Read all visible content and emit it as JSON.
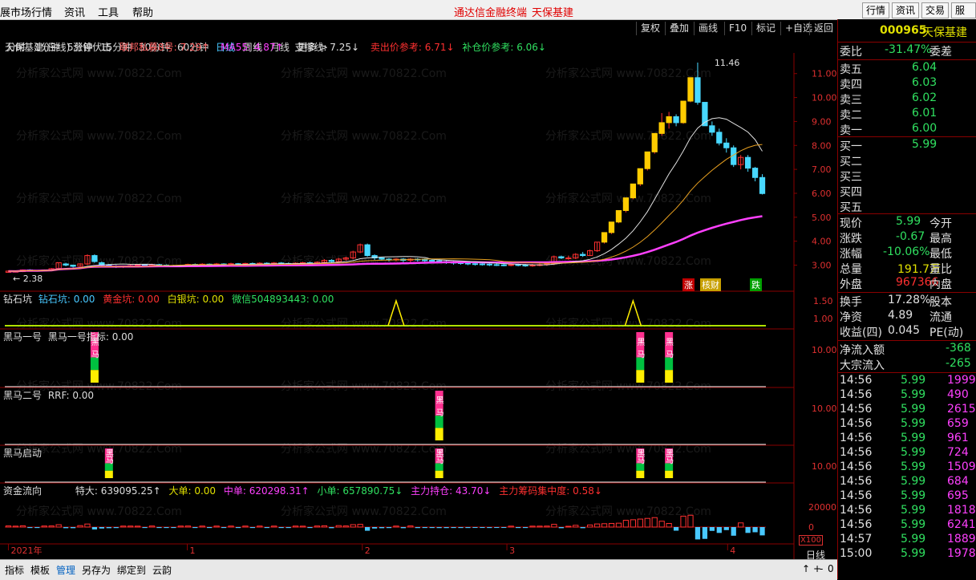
{
  "menu": {
    "app_title": "展市场行情",
    "items": [
      "资讯",
      "工具",
      "帮助"
    ],
    "center_title": "通达信金融终端",
    "stock_title": "天保基建",
    "right_buttons": [
      "行情",
      "资讯",
      "交易",
      "服务"
    ]
  },
  "toolbar": {
    "buttons": [
      "复权",
      "叠加",
      "画线",
      "F10",
      "标记",
      "+自选",
      "返回"
    ]
  },
  "timeframes": {
    "items": [
      "分时",
      "1分钟",
      "5分钟",
      "15分钟",
      "30分钟",
      "60分钟",
      "日线",
      "周线",
      "月线",
      "更多 >"
    ],
    "active": "日线"
  },
  "main_panel": {
    "header": [
      {
        "text": "天保基建(日线) 涨停伏击",
        "color": "#dddddd"
      },
      {
        "text": "联邦私募8号: 7.29↑",
        "color": "#ff6060"
      },
      {
        "text": "MA55: 4.87↑",
        "color": "#ff40ff"
      },
      {
        "text": "支撑线: 7.25↓",
        "color": "#e0e0e0"
      },
      {
        "text": "卖出价参考: 6.71↓",
        "color": "#ff3030"
      },
      {
        "text": "补仓价参考: 6.06↓",
        "color": "#30e060"
      }
    ],
    "y_ticks": [
      "11.00",
      "10.00",
      "9.00",
      "8.00",
      "7.00",
      "6.00",
      "5.00",
      "4.00",
      "3.00"
    ],
    "max_label": "11.46",
    "min_label": "2.38",
    "markers": [
      {
        "text": "涨",
        "bg": "#c00000"
      },
      {
        "text": "核财",
        "bg": "#c8a000"
      },
      {
        "text": "跌",
        "bg": "#00a000"
      }
    ]
  },
  "chart_data": {
    "type": "candlestick",
    "price_range": [
      2.38,
      11.46
    ],
    "y_ticks": [
      3,
      4,
      5,
      6,
      7,
      8,
      9,
      10,
      11
    ],
    "x_labels": [
      "2021年",
      "1",
      "2",
      "3",
      "4"
    ],
    "candles": [
      [
        2.7,
        2.75,
        2.68,
        2.78
      ],
      [
        2.72,
        2.74,
        2.7,
        2.77
      ],
      [
        2.73,
        2.8,
        2.71,
        2.82
      ],
      [
        2.8,
        2.78,
        2.75,
        2.83
      ],
      [
        2.78,
        2.76,
        2.73,
        2.8
      ],
      [
        2.76,
        2.8,
        2.74,
        2.82
      ],
      [
        2.8,
        2.85,
        2.78,
        2.88
      ],
      [
        2.86,
        3.1,
        2.85,
        3.12
      ],
      [
        3.05,
        3.0,
        2.95,
        3.1
      ],
      [
        3.0,
        2.95,
        2.9,
        3.02
      ],
      [
        2.95,
        3.05,
        2.92,
        3.08
      ],
      [
        3.05,
        3.4,
        3.0,
        3.45
      ],
      [
        3.4,
        3.15,
        3.1,
        3.45
      ],
      [
        3.1,
        3.0,
        2.95,
        3.15
      ],
      [
        3.0,
        2.95,
        2.9,
        3.05
      ],
      [
        2.95,
        2.92,
        2.88,
        3.0
      ],
      [
        2.92,
        2.95,
        2.88,
        2.98
      ],
      [
        2.95,
        2.98,
        2.9,
        3.02
      ],
      [
        2.98,
        3.0,
        2.93,
        3.04
      ],
      [
        3.0,
        2.98,
        2.94,
        3.05
      ],
      [
        2.98,
        3.02,
        2.95,
        3.06
      ],
      [
        3.02,
        3.0,
        2.96,
        3.05
      ],
      [
        3.0,
        2.98,
        2.94,
        3.03
      ],
      [
        2.98,
        2.96,
        2.92,
        3.01
      ],
      [
        2.96,
        2.99,
        2.93,
        3.02
      ],
      [
        2.99,
        3.03,
        2.96,
        3.06
      ],
      [
        3.03,
        3.01,
        2.97,
        3.07
      ],
      [
        3.01,
        3.04,
        2.98,
        3.08
      ],
      [
        3.04,
        3.02,
        2.99,
        3.07
      ],
      [
        3.02,
        3.05,
        2.99,
        3.09
      ],
      [
        3.05,
        3.03,
        3.0,
        3.08
      ],
      [
        3.03,
        3.06,
        3.0,
        3.1
      ],
      [
        3.06,
        3.04,
        3.01,
        3.09
      ],
      [
        3.04,
        3.07,
        3.01,
        3.1
      ],
      [
        3.07,
        3.05,
        3.02,
        3.11
      ],
      [
        3.05,
        3.08,
        3.02,
        3.12
      ],
      [
        3.08,
        3.06,
        3.03,
        3.12
      ],
      [
        3.06,
        3.09,
        3.03,
        3.13
      ],
      [
        3.09,
        3.07,
        3.04,
        3.13
      ],
      [
        3.07,
        3.05,
        3.02,
        3.11
      ],
      [
        3.05,
        3.08,
        3.02,
        3.12
      ],
      [
        3.08,
        3.1,
        3.04,
        3.14
      ],
      [
        3.1,
        3.08,
        3.05,
        3.14
      ],
      [
        3.08,
        3.12,
        3.05,
        3.16
      ],
      [
        3.12,
        3.2,
        3.08,
        3.25
      ],
      [
        3.2,
        3.15,
        3.1,
        3.25
      ],
      [
        3.15,
        3.25,
        3.12,
        3.3
      ],
      [
        3.25,
        3.3,
        3.18,
        3.35
      ],
      [
        3.3,
        3.55,
        3.25,
        3.6
      ],
      [
        3.55,
        3.85,
        3.5,
        3.9
      ],
      [
        3.85,
        3.4,
        3.35,
        3.9
      ],
      [
        3.4,
        3.3,
        3.22,
        3.45
      ],
      [
        3.3,
        3.25,
        3.18,
        3.35
      ],
      [
        3.25,
        3.22,
        3.15,
        3.3
      ],
      [
        3.22,
        3.25,
        3.15,
        3.3
      ],
      [
        3.25,
        3.2,
        3.12,
        3.3
      ],
      [
        3.2,
        3.25,
        3.12,
        3.3
      ],
      [
        3.25,
        3.22,
        3.15,
        3.3
      ],
      [
        3.22,
        3.2,
        3.12,
        3.28
      ],
      [
        3.2,
        3.18,
        3.1,
        3.25
      ],
      [
        3.18,
        3.15,
        3.08,
        3.25
      ],
      [
        3.15,
        3.12,
        3.05,
        3.2
      ],
      [
        3.12,
        3.1,
        3.02,
        3.18
      ],
      [
        3.1,
        3.08,
        3.02,
        3.15
      ],
      [
        3.08,
        3.06,
        3.0,
        3.14
      ],
      [
        3.06,
        3.05,
        2.98,
        3.12
      ],
      [
        3.05,
        3.04,
        2.98,
        3.1
      ],
      [
        3.04,
        3.02,
        2.96,
        3.09
      ],
      [
        3.02,
        3.01,
        2.96,
        3.08
      ],
      [
        3.01,
        3.0,
        2.95,
        3.06
      ],
      [
        3.0,
        3.02,
        2.95,
        3.07
      ],
      [
        3.02,
        3.0,
        2.95,
        3.06
      ],
      [
        3.0,
        2.98,
        2.93,
        3.05
      ],
      [
        2.98,
        3.0,
        2.93,
        3.05
      ],
      [
        3.0,
        3.02,
        2.95,
        3.07
      ],
      [
        3.02,
        3.05,
        2.97,
        3.1
      ],
      [
        3.05,
        3.35,
        3.0,
        3.4
      ],
      [
        3.35,
        3.3,
        3.25,
        3.4
      ],
      [
        3.3,
        3.3,
        3.22,
        3.4
      ],
      [
        3.3,
        3.45,
        3.25,
        3.5
      ],
      [
        3.45,
        3.4,
        3.35,
        3.55
      ],
      [
        3.4,
        3.6,
        3.38,
        3.65
      ],
      [
        3.6,
        3.96,
        3.55,
        3.96
      ],
      [
        3.96,
        4.36,
        3.9,
        4.36
      ],
      [
        4.36,
        4.8,
        4.3,
        4.8
      ],
      [
        4.8,
        5.28,
        4.75,
        5.28
      ],
      [
        5.28,
        5.81,
        5.2,
        5.81
      ],
      [
        5.81,
        6.39,
        5.75,
        6.39
      ],
      [
        6.39,
        7.03,
        6.3,
        7.03
      ],
      [
        7.03,
        7.73,
        6.95,
        7.73
      ],
      [
        7.73,
        8.5,
        7.65,
        8.5
      ],
      [
        8.5,
        8.95,
        8.4,
        9.35
      ],
      [
        8.95,
        9.2,
        8.7,
        9.4
      ],
      [
        9.2,
        8.95,
        8.8,
        9.3
      ],
      [
        8.95,
        9.85,
        8.9,
        9.85
      ],
      [
        9.85,
        10.83,
        9.8,
        10.83
      ],
      [
        10.83,
        9.8,
        9.7,
        11.46
      ],
      [
        9.8,
        8.82,
        8.82,
        9.8
      ],
      [
        8.82,
        8.55,
        8.4,
        9.0
      ],
      [
        8.55,
        8.1,
        8.0,
        8.7
      ],
      [
        8.1,
        7.9,
        7.7,
        8.3
      ],
      [
        7.9,
        7.2,
        7.1,
        8.0
      ],
      [
        7.2,
        7.5,
        7.0,
        7.6
      ],
      [
        7.5,
        7.05,
        6.9,
        7.6
      ],
      [
        7.05,
        6.66,
        6.5,
        7.1
      ],
      [
        6.66,
        5.99,
        5.95,
        6.8
      ]
    ],
    "ma_series": [
      {
        "name": "MA55",
        "color": "#ff40ff",
        "last": 4.87
      },
      {
        "name": "支撑线",
        "color": "#e0e0e0",
        "last": 7.25
      },
      {
        "name": "联邦私募8号",
        "color": "#e8a020",
        "last": 7.29
      }
    ]
  },
  "indicators": [
    {
      "name": "钻石坑",
      "header": [
        {
          "text": "钻石坑",
          "color": "#dddddd"
        },
        {
          "text": "钻石坑: 0.00",
          "color": "#48c8ff"
        },
        {
          "text": "黄金坑: 0.00",
          "color": "#ff3030"
        },
        {
          "text": "白银坑: 0.00",
          "color": "#e0e000"
        },
        {
          "text": "微信504893443: 0.00",
          "color": "#30e060"
        }
      ],
      "y_ticks": [
        "1.50",
        "1.00"
      ],
      "signals": [
        {
          "day": 54,
          "height": 1
        },
        {
          "day": 87,
          "height": 1
        }
      ]
    },
    {
      "name": "黑马一号",
      "header": [
        {
          "text": "黑马一号",
          "color": "#dddddd"
        },
        {
          "text": "黑马一号指标: 0.00",
          "color": "#dddddd"
        }
      ],
      "y_ticks": [
        "10.00"
      ],
      "signals": [
        {
          "day": 12,
          "height": 1
        },
        {
          "day": 88,
          "height": 1
        },
        {
          "day": 92,
          "height": 1
        }
      ]
    },
    {
      "name": "黑马二号",
      "header": [
        {
          "text": "黑马二号",
          "color": "#dddddd"
        },
        {
          "text": "RRF: 0.00",
          "color": "#dddddd"
        }
      ],
      "y_ticks": [
        "10.00"
      ],
      "signals": [
        {
          "day": 60,
          "height": 1
        }
      ]
    },
    {
      "name": "黑马启动",
      "header": [
        {
          "text": "黑马启动",
          "color": "#dddddd"
        }
      ],
      "y_ticks": [
        "10.00"
      ],
      "signals": [
        {
          "day": 14,
          "height": 1
        },
        {
          "day": 60,
          "height": 1
        },
        {
          "day": 88,
          "height": 1
        },
        {
          "day": 92,
          "height": 1
        }
      ]
    },
    {
      "name": "资金流向",
      "header": [
        {
          "text": "资金流向",
          "color": "#dddddd"
        },
        {
          "text": "特大: 639095.25↑",
          "color": "#dddddd"
        },
        {
          "text": "大单: 0.00",
          "color": "#e0e000"
        },
        {
          "text": "中单: 620298.31↑",
          "color": "#ff40ff"
        },
        {
          "text": "小单: 657890.75↓",
          "color": "#30e060"
        },
        {
          "text": "主力持仓: 43.70↓",
          "color": "#ff40ff"
        },
        {
          "text": "主力筹码集中度: 0.58↓",
          "color": "#ff3030"
        }
      ],
      "y_ticks": [
        "20000",
        "0"
      ],
      "scale_label": "X100"
    }
  ],
  "x_axis": {
    "labels": [
      "2021年",
      "1",
      "2",
      "3",
      "4"
    ],
    "mode_label": "日线"
  },
  "bottom_tabs": [
    "指标",
    "模板",
    "管理",
    "另存为",
    "绑定到",
    "云韵"
  ],
  "bottom_controls": [
    "↑",
    "+",
    "-",
    "0"
  ],
  "quote": {
    "code": "000965",
    "name": "天保基建",
    "weibi_label": "委比",
    "weibi": "-31.47%",
    "weicha_label": "委差",
    "asks": [
      {
        "label": "卖五",
        "price": "6.04"
      },
      {
        "label": "卖四",
        "price": "6.03"
      },
      {
        "label": "卖三",
        "price": "6.02"
      },
      {
        "label": "卖二",
        "price": "6.01"
      },
      {
        "label": "卖一",
        "price": "6.00"
      }
    ],
    "bids": [
      {
        "label": "买一",
        "price": "5.99"
      },
      {
        "label": "买二",
        "price": ""
      },
      {
        "label": "买三",
        "price": ""
      },
      {
        "label": "买四",
        "price": ""
      },
      {
        "label": "买五",
        "price": ""
      }
    ],
    "stats": [
      {
        "l": "现价",
        "v": "5.99",
        "c": "#30e060",
        "r": "今开"
      },
      {
        "l": "涨跌",
        "v": "-0.67",
        "c": "#30e060",
        "r": "最高"
      },
      {
        "l": "涨幅",
        "v": "-10.06%",
        "c": "#30e060",
        "r": "最低"
      },
      {
        "l": "总量",
        "v": "191.7万",
        "c": "#e0e000",
        "r": "量比"
      },
      {
        "l": "外盘",
        "v": "967366",
        "c": "#ff3030",
        "r": "内盘"
      }
    ],
    "stats2": [
      {
        "l": "换手",
        "v": "17.28%",
        "c": "#e0e0e0",
        "r": "股本"
      },
      {
        "l": "净资",
        "v": "4.89",
        "c": "#e0e0e0",
        "r": "流通"
      },
      {
        "l": "收益(四)",
        "v": "0.045",
        "c": "#e0e0e0",
        "r": "PE(动)"
      }
    ],
    "flow": [
      {
        "l": "净流入额",
        "v": "-368"
      },
      {
        "l": "大宗流入",
        "v": "-265"
      }
    ],
    "ticks": [
      {
        "t": "14:56",
        "p": "5.99",
        "v": "1999"
      },
      {
        "t": "14:56",
        "p": "5.99",
        "v": "490"
      },
      {
        "t": "14:56",
        "p": "5.99",
        "v": "2615"
      },
      {
        "t": "14:56",
        "p": "5.99",
        "v": "659"
      },
      {
        "t": "14:56",
        "p": "5.99",
        "v": "961"
      },
      {
        "t": "14:56",
        "p": "5.99",
        "v": "724"
      },
      {
        "t": "14:56",
        "p": "5.99",
        "v": "1509"
      },
      {
        "t": "14:56",
        "p": "5.99",
        "v": "684"
      },
      {
        "t": "14:56",
        "p": "5.99",
        "v": "695"
      },
      {
        "t": "14:56",
        "p": "5.99",
        "v": "1818"
      },
      {
        "t": "14:56",
        "p": "5.99",
        "v": "6241"
      },
      {
        "t": "14:57",
        "p": "5.99",
        "v": "1889"
      },
      {
        "t": "15:00",
        "p": "5.99",
        "v": "19788"
      }
    ]
  },
  "watermark": "分析家公式网 www.70822.Com"
}
